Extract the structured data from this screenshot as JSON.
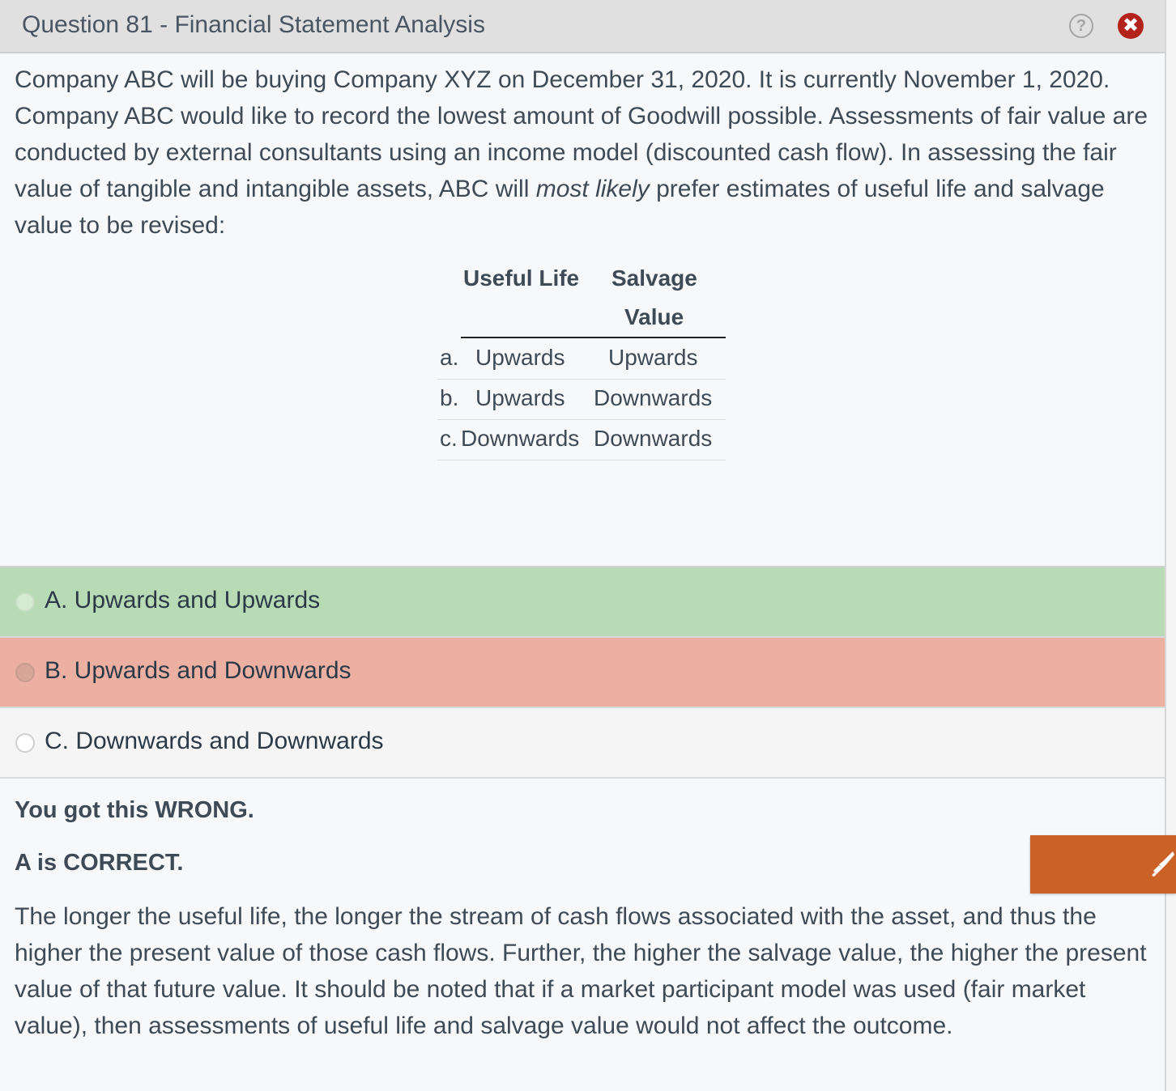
{
  "header": {
    "title": "Question 81 - Financial Statement Analysis",
    "help_icon": "?",
    "close_icon": "✖"
  },
  "question": {
    "text_before": "Company ABC will be buying Company XYZ on December 31, 2020.  It is currently November 1, 2020.  Company ABC would like to record the lowest amount of Goodwill possible.  Assessments of fair value are conducted by external consultants using an income model (discounted cash flow).  In assessing the fair value of tangible and intangible assets, ABC will ",
    "text_emphasis": "most likely",
    "text_after": " prefer estimates of useful life and salvage value to be revised:"
  },
  "table": {
    "headers": [
      "Useful Life",
      "Salvage",
      "Value"
    ],
    "rows": [
      {
        "label": "a.",
        "useful_life": "Upwards",
        "salvage_value": "Upwards"
      },
      {
        "label": "b.",
        "useful_life": "Upwards",
        "salvage_value": "Downwards"
      },
      {
        "label": "c.",
        "useful_life": "Downwards",
        "salvage_value": "Downwards"
      }
    ]
  },
  "choices": [
    {
      "label": "A. Upwards and Upwards",
      "state": "correct",
      "color": "#b8dab5"
    },
    {
      "label": "B. Upwards and Downwards",
      "state": "selected-wrong",
      "color": "#ebb0a2"
    },
    {
      "label": "C. Downwards and Downwards",
      "state": "neutral",
      "color": "#f5f5f5"
    }
  ],
  "feedback": {
    "result": "You got this WRONG.",
    "correct_answer": "A is CORRECT.",
    "explanation": "The longer the useful life, the longer the stream of cash flows associated with the asset, and thus the higher the present value of those cash flows.  Further, the higher the salvage value, the higher the present value of that future value.  It should be noted that if a market participant model was used (fair market value), then assessments of useful life and salvage value would not affect the outcome."
  },
  "highlight_tool": {
    "icon": "highlighter-icon",
    "color": "#cc6126"
  }
}
